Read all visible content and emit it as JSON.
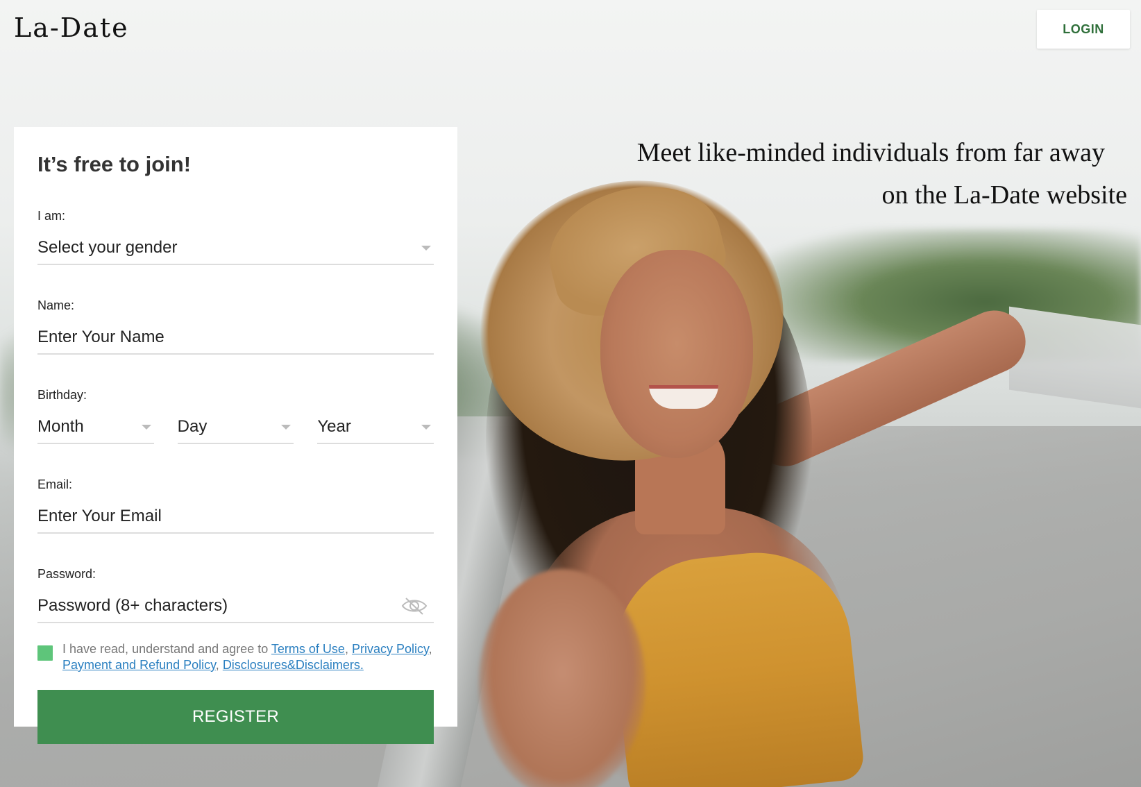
{
  "header": {
    "logo": "La-Date",
    "login_label": "LOGIN"
  },
  "hero": {
    "tagline_line1": "Meet like-minded individuals from far away",
    "tagline_line2": "on the La-Date website"
  },
  "form": {
    "title": "It’s free to join!",
    "gender": {
      "label": "I am:",
      "value": "Select your gender"
    },
    "name": {
      "label": "Name:",
      "placeholder": "Enter Your Name"
    },
    "birthday": {
      "label": "Birthday:",
      "month": "Month",
      "day": "Day",
      "year": "Year"
    },
    "email": {
      "label": "Email:",
      "placeholder": "Enter Your Email"
    },
    "password": {
      "label": "Password:",
      "placeholder": "Password (8+ characters)"
    },
    "terms": {
      "prefix": "I have read, understand and agree to ",
      "terms_of_use": "Terms of Use",
      "sep1": ", ",
      "privacy_policy": "Privacy Policy",
      "sep2": ", ",
      "refund_policy": "Payment and Refund Policy",
      "sep3": ", ",
      "disclaimers": "Disclosures&Disclaimers.",
      "checked": true
    },
    "register_label": "REGISTER"
  },
  "colors": {
    "accent_green": "#3f8e50",
    "checkbox_green": "#5ec57a",
    "link_blue": "#2a7fc0",
    "login_text": "#2f6f3a"
  },
  "icons": {
    "password_toggle": "eye-slash-icon",
    "select_caret": "chevron-down-icon"
  }
}
